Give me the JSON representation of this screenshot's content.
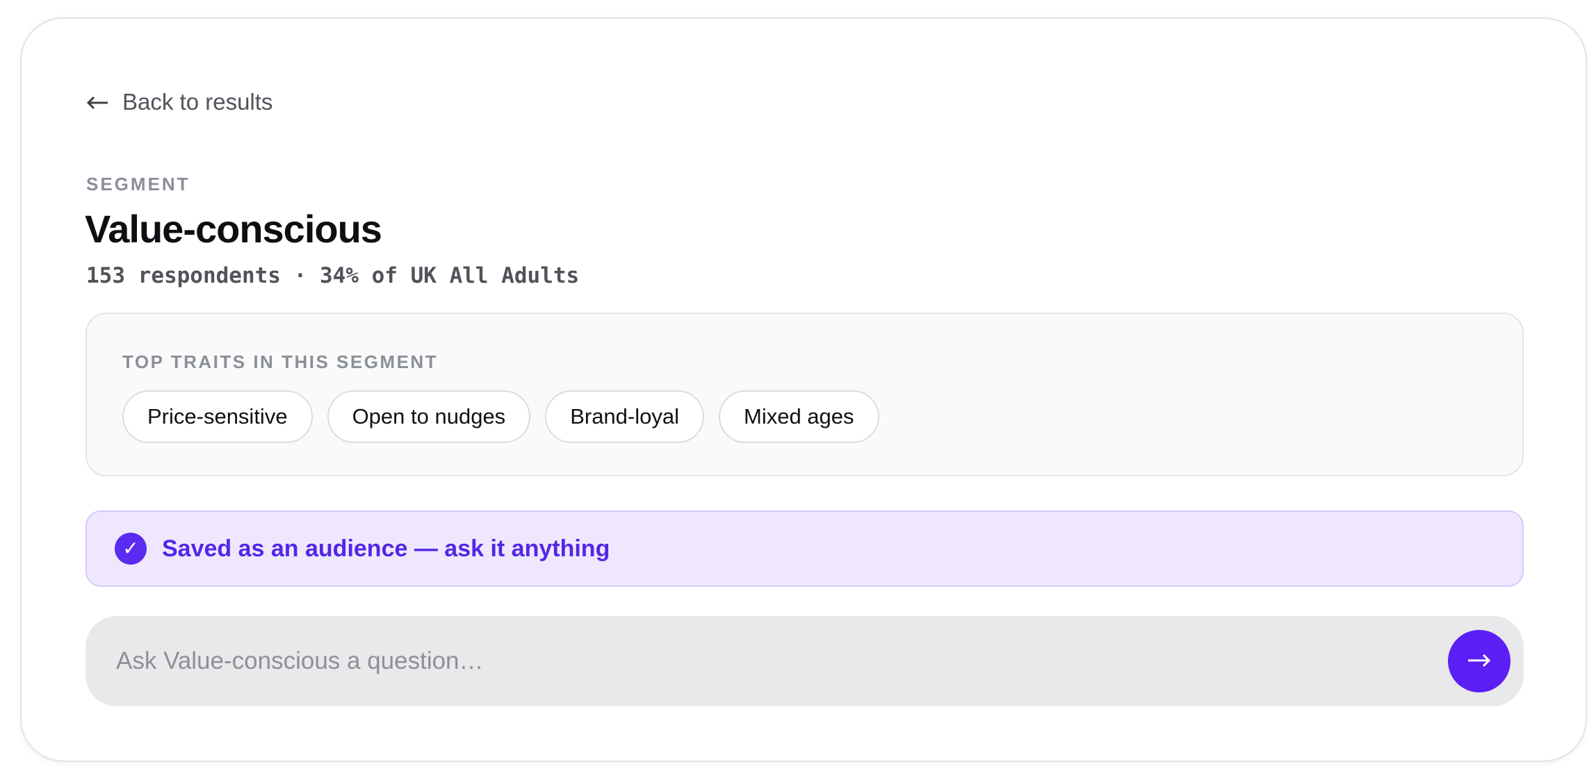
{
  "back": {
    "label": "Back to results",
    "icon": "arrow-left-icon"
  },
  "segment": {
    "eyebrow": "SEGMENT",
    "name": "Value-conscious",
    "meta": "153 respondents · 34% of UK All Adults"
  },
  "traits": {
    "label": "TOP TRAITS IN THIS SEGMENT",
    "items": [
      "Price-sensitive",
      "Open to nudges",
      "Brand-loyal",
      "Mixed ages"
    ]
  },
  "banner": {
    "text": "Saved as an audience — ask it anything",
    "icon": "check-circle-icon",
    "check_glyph": "✓"
  },
  "ask": {
    "placeholder": "Ask Value-conscious a question…",
    "value": "",
    "send_icon": "arrow-right-icon"
  },
  "colors": {
    "accent": "#5b1ff5",
    "banner_bg": "#efe7fe",
    "banner_text": "#5326e6",
    "muted": "#8a8f98"
  }
}
